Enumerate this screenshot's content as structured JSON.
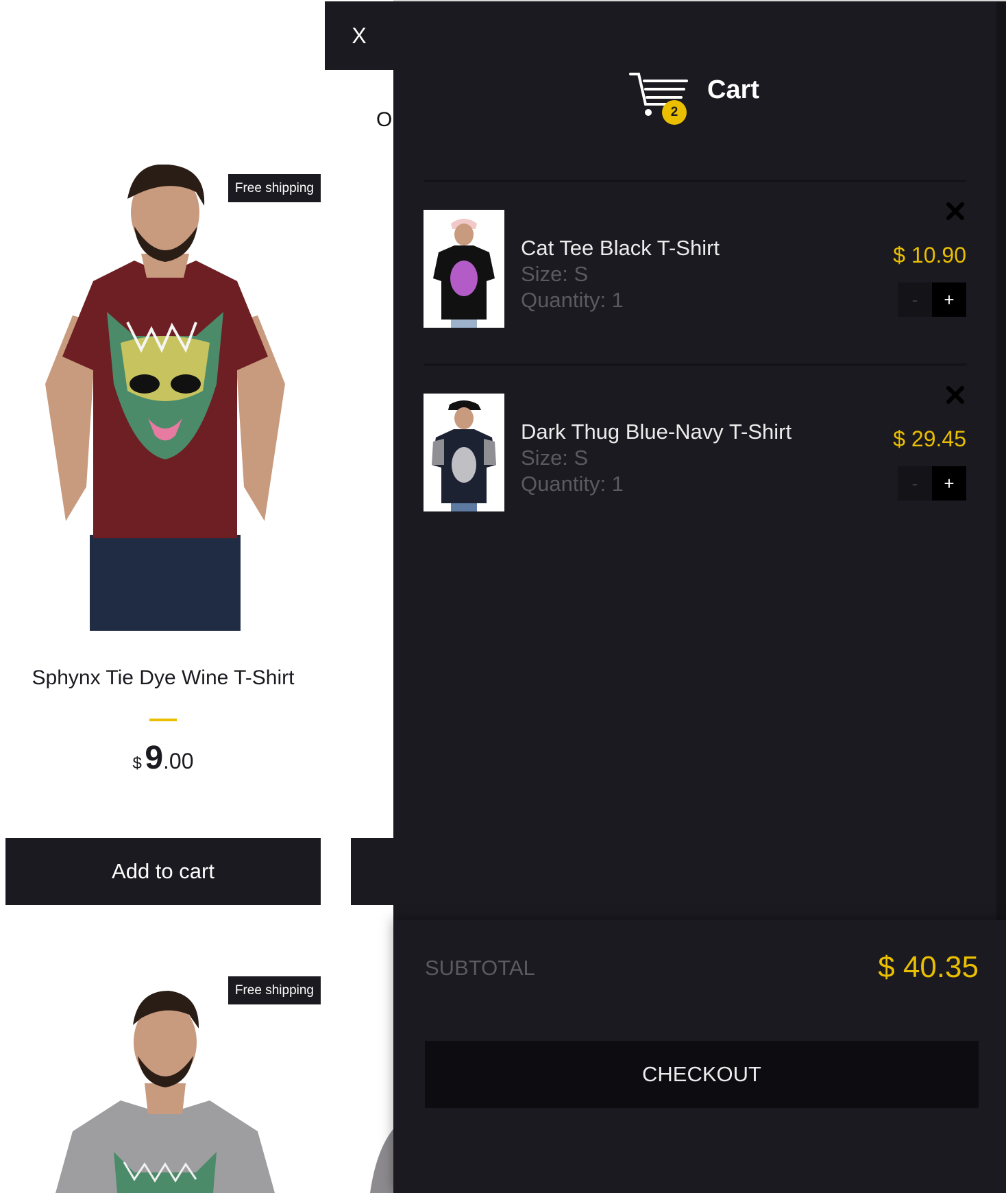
{
  "shop": {
    "partial_header_text": "O",
    "products": [
      {
        "badge": "Free shipping",
        "title": "Sphynx Tie Dye Wine T-Shirt",
        "price_currency": "$",
        "price_integer": "9",
        "price_decimal": ".00",
        "add_to_cart_label": "Add to cart"
      },
      {
        "badge": "Free shipping"
      }
    ]
  },
  "close_tab": {
    "label": "X"
  },
  "cart": {
    "title": "Cart",
    "count": "2",
    "items": [
      {
        "name": "Cat Tee Black T-Shirt",
        "size": "Size: S",
        "quantity": "Quantity: 1",
        "price": "$ 10.90",
        "minus_label": "-",
        "plus_label": "+"
      },
      {
        "name": "Dark Thug Blue-Navy T-Shirt",
        "size": "Size: S",
        "quantity": "Quantity: 1",
        "price": "$ 29.45",
        "minus_label": "-",
        "plus_label": "+"
      }
    ],
    "subtotal_label": "SUBTOTAL",
    "subtotal_value": "$ 40.35",
    "checkout_label": "CHECKOUT"
  },
  "colors": {
    "panel_bg": "#1b1a20",
    "accent_yellow": "#eabf00",
    "muted_text": "#5b5a5e"
  }
}
